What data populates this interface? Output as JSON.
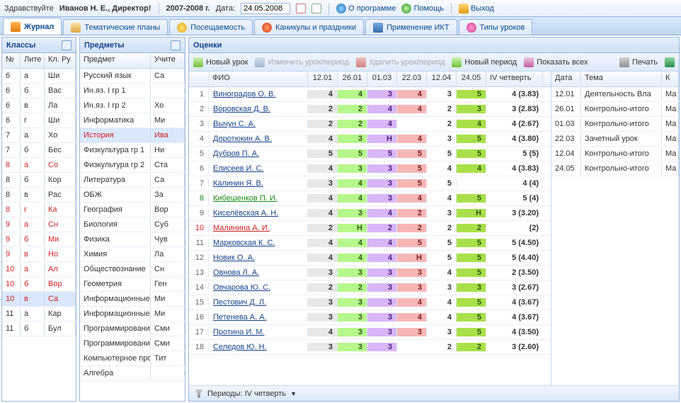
{
  "topbar": {
    "greeting": "Здравствуйте",
    "user": "Иванов Н. Е., Директор!",
    "year": "2007-2008 г.",
    "date_label": "Дата:",
    "date": "24.05.2008",
    "about": "О программе",
    "help": "Помощь",
    "exit": "Выход"
  },
  "tabs": [
    {
      "label": "Журнал"
    },
    {
      "label": "Тематические планы"
    },
    {
      "label": "Посещаемость"
    },
    {
      "label": "Каникулы и праздники"
    },
    {
      "label": "Применение ИКТ"
    },
    {
      "label": "Типы уроков"
    }
  ],
  "classes": {
    "title": "Классы",
    "cols": [
      "№",
      "Лите",
      "Кл. Ру"
    ],
    "rows": [
      {
        "n": "6",
        "l": "а",
        "r": "Ши"
      },
      {
        "n": "6",
        "l": "б",
        "r": "Вас"
      },
      {
        "n": "6",
        "l": "в",
        "r": "Ла"
      },
      {
        "n": "6",
        "l": "г",
        "r": "Ши"
      },
      {
        "n": "7",
        "l": "а",
        "r": "Хо"
      },
      {
        "n": "7",
        "l": "б",
        "r": "Бес"
      },
      {
        "n": "8",
        "l": "а",
        "r": "Со",
        "red": true
      },
      {
        "n": "8",
        "l": "б",
        "r": "Кор"
      },
      {
        "n": "8",
        "l": "в",
        "r": "Рас"
      },
      {
        "n": "8",
        "l": "г",
        "r": "Ка",
        "red": true
      },
      {
        "n": "9",
        "l": "а",
        "r": "Сн",
        "red": true
      },
      {
        "n": "9",
        "l": "б",
        "r": "Ми",
        "red": true
      },
      {
        "n": "9",
        "l": "в",
        "r": "Но",
        "red": true
      },
      {
        "n": "10",
        "l": "а",
        "r": "Ал",
        "red": true
      },
      {
        "n": "10",
        "l": "б",
        "r": "Вор",
        "red": true
      },
      {
        "n": "10",
        "l": "в",
        "r": "Са",
        "red": true,
        "sel": true
      },
      {
        "n": "11",
        "l": "а",
        "r": "Кар"
      },
      {
        "n": "11",
        "l": "б",
        "r": "Бул"
      }
    ]
  },
  "subjects": {
    "title": "Предметы",
    "cols": [
      "Предмет",
      "Учите"
    ],
    "rows": [
      {
        "p": "Русский язык",
        "t": "Са"
      },
      {
        "p": "Ин.яз. I гр 1",
        "t": ""
      },
      {
        "p": "Ин.яз. I гр 2",
        "t": "Хо"
      },
      {
        "p": "Информатика",
        "t": "Ми"
      },
      {
        "p": "История",
        "t": "Ива",
        "sel": true,
        "red": true
      },
      {
        "p": "Физкультура гр 1",
        "t": "Ни"
      },
      {
        "p": "Физкультура гр 2",
        "t": "Ста"
      },
      {
        "p": "Литература",
        "t": "Са"
      },
      {
        "p": "ОБЖ",
        "t": "За"
      },
      {
        "p": "География",
        "t": "Вор"
      },
      {
        "p": "Биология",
        "t": "Суб"
      },
      {
        "p": "Физика",
        "t": "Чув"
      },
      {
        "p": "Химия",
        "t": "Ла"
      },
      {
        "p": "Обществознание",
        "t": "Сн"
      },
      {
        "p": "Геометрия",
        "t": "Ген"
      },
      {
        "p": "Информационные т",
        "t": "Ми"
      },
      {
        "p": "Информационные т",
        "t": "Ми"
      },
      {
        "p": "Программирование",
        "t": "Сми"
      },
      {
        "p": "Программирование",
        "t": "Сми"
      },
      {
        "p": "Компьютерное про",
        "t": "Тит"
      },
      {
        "p": "Алгебра",
        "t": ""
      }
    ]
  },
  "marks": {
    "title": "Оценки",
    "toolbar": {
      "new_lesson": "Новый урок",
      "edit": "Изменить урок/период",
      "del": "Удалить урок/период",
      "new_period": "Новый период",
      "show_all": "Показать всех",
      "print": "Печать"
    },
    "cols": [
      "ФИО",
      "12.01",
      "26.01",
      "01.03",
      "22.03",
      "12.04",
      "24.05",
      "IV четверть"
    ],
    "rows": [
      {
        "n": 1,
        "fio": "Виноградов О. В.",
        "m": [
          "4",
          "4",
          "3",
          "4",
          "3",
          "5"
        ],
        "q": "4 (3.83)"
      },
      {
        "n": 2,
        "fio": "Воровская Д. В.",
        "m": [
          "2",
          "2",
          "4",
          "4",
          "2",
          "3"
        ],
        "q": "3 (2.83)"
      },
      {
        "n": 3,
        "fio": "Вычун С. А.",
        "m": [
          "2",
          "2",
          "4",
          "",
          "2",
          "4"
        ],
        "q": "4 (2.67)"
      },
      {
        "n": 4,
        "fio": "Доротюкин А. В.",
        "m": [
          "4",
          "3",
          "Н",
          "4",
          "3",
          "5"
        ],
        "q": "4 (3.80)"
      },
      {
        "n": 5,
        "fio": "Дубров П. А.",
        "m": [
          "5",
          "5",
          "5",
          "5",
          "5",
          "5"
        ],
        "q": "5 (5)"
      },
      {
        "n": 6,
        "fio": "Елисеев И. С.",
        "m": [
          "4",
          "3",
          "3",
          "5",
          "4",
          "4"
        ],
        "q": "4 (3.83)"
      },
      {
        "n": 7,
        "fio": "Калинин Я. В.",
        "m": [
          "3",
          "4",
          "3",
          "5",
          "5",
          ""
        ],
        "q": "4 (4)"
      },
      {
        "n": 8,
        "fio": "Кибешенков П. И.",
        "m": [
          "4",
          "4",
          "3",
          "4",
          "4",
          "5"
        ],
        "q": "5 (4)",
        "green": true
      },
      {
        "n": 9,
        "fio": "Киселёвская А. Н.",
        "m": [
          "4",
          "3",
          "4",
          "2",
          "3",
          "Н"
        ],
        "q": "3 (3.20)"
      },
      {
        "n": 10,
        "fio": "Малинина А. И.",
        "m": [
          "2",
          "Н",
          "2",
          "2",
          "2",
          "2"
        ],
        "q": "(2)",
        "red": true
      },
      {
        "n": 11,
        "fio": "Марковская К. С.",
        "m": [
          "4",
          "4",
          "4",
          "5",
          "5",
          "5"
        ],
        "q": "5 (4.50)"
      },
      {
        "n": 12,
        "fio": "Новик О. А.",
        "m": [
          "4",
          "4",
          "4",
          "Н",
          "5",
          "5"
        ],
        "q": "5 (4.40)"
      },
      {
        "n": 13,
        "fio": "Овнова Л. А.",
        "m": [
          "3",
          "3",
          "3",
          "3",
          "4",
          "5"
        ],
        "q": "2 (3.50)"
      },
      {
        "n": 14,
        "fio": "Овчарова Ю. С.",
        "m": [
          "2",
          "2",
          "3",
          "3",
          "3",
          "3"
        ],
        "q": "3 (2.67)"
      },
      {
        "n": 15,
        "fio": "Пестович Д. Л.",
        "m": [
          "3",
          "3",
          "3",
          "4",
          "4",
          "5"
        ],
        "q": "4 (3.67)"
      },
      {
        "n": 16,
        "fio": "Петенева А. А.",
        "m": [
          "3",
          "3",
          "3",
          "4",
          "4",
          "5"
        ],
        "q": "4 (3.67)"
      },
      {
        "n": 17,
        "fio": "Протина И. М.",
        "m": [
          "4",
          "3",
          "3",
          "3",
          "3",
          "5"
        ],
        "q": "4 (3.50)"
      },
      {
        "n": 18,
        "fio": "Селедов Ю. Н.",
        "m": [
          "3",
          "3",
          "3",
          "",
          "2",
          "2"
        ],
        "q": "3 (2.60)"
      }
    ],
    "dates": {
      "cols": [
        "Дата",
        "Тема",
        "К"
      ],
      "rows": [
        {
          "d": "12.01",
          "t": "Деятельность Вла",
          "k": "Ма"
        },
        {
          "d": "26.01",
          "t": "Контрольно-итого",
          "k": "Ма"
        },
        {
          "d": "01.03",
          "t": "Контрольно-итого",
          "k": "Ма"
        },
        {
          "d": "22.03",
          "t": "Зачетный урок",
          "k": "Ма"
        },
        {
          "d": "12.04",
          "t": "Контрольно-итого",
          "k": "Ма"
        },
        {
          "d": "24.05",
          "t": "Контрольно-итого",
          "k": "Ма"
        }
      ]
    }
  },
  "footer": {
    "periods": "Периоды: IV четверть"
  },
  "colclasses": [
    "c-def",
    "c-grn",
    "c-vio",
    "c-pnk",
    "c-non",
    "c-lim"
  ]
}
